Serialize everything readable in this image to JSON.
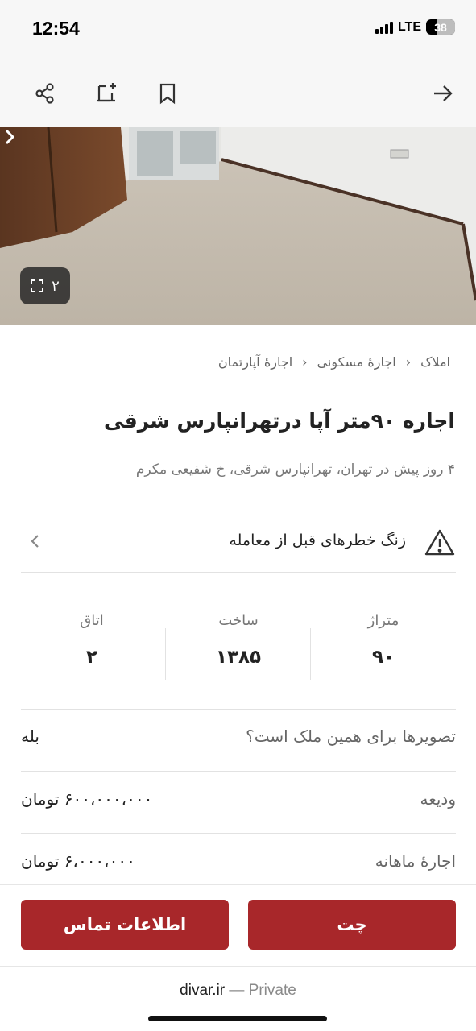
{
  "status_bar": {
    "time": "12:54",
    "network": "LTE",
    "battery": "38"
  },
  "toolbar": {
    "icons": [
      "share-icon",
      "add-note-icon",
      "bookmark-icon",
      "back-arrow-icon"
    ]
  },
  "gallery": {
    "photo_count": "۲"
  },
  "breadcrumb": {
    "items": [
      "املاک",
      "اجارهٔ مسکونی",
      "اجارهٔ آپارتمان"
    ]
  },
  "listing": {
    "title": "اجاره ۹۰متر آپا درتهرانپارس شرقی",
    "subtitle": "۴ روز پیش در تهران، تهرانپارس شرقی، خ شفیعی مکرم"
  },
  "warning": {
    "text": "زنگ خطرهای قبل از معامله"
  },
  "stats": [
    {
      "label": "متراژ",
      "value": "۹۰"
    },
    {
      "label": "ساخت",
      "value": "۱۳۸۵"
    },
    {
      "label": "اتاق",
      "value": "۲"
    }
  ],
  "details": [
    {
      "label": "تصویرها برای همین ملک است؟",
      "value": "بله"
    },
    {
      "label": "ودیعه",
      "value": "۶۰۰،۰۰۰،۰۰۰ تومان"
    },
    {
      "label": "اجارهٔ ماهانه",
      "value": "۶،۰۰۰،۰۰۰ تومان"
    }
  ],
  "actions": {
    "chat": "چت",
    "contact": "اطلاعات تماس"
  },
  "footer": {
    "domain": "divar.ir",
    "mode": "— Private"
  },
  "colors": {
    "accent": "#a8272a"
  }
}
